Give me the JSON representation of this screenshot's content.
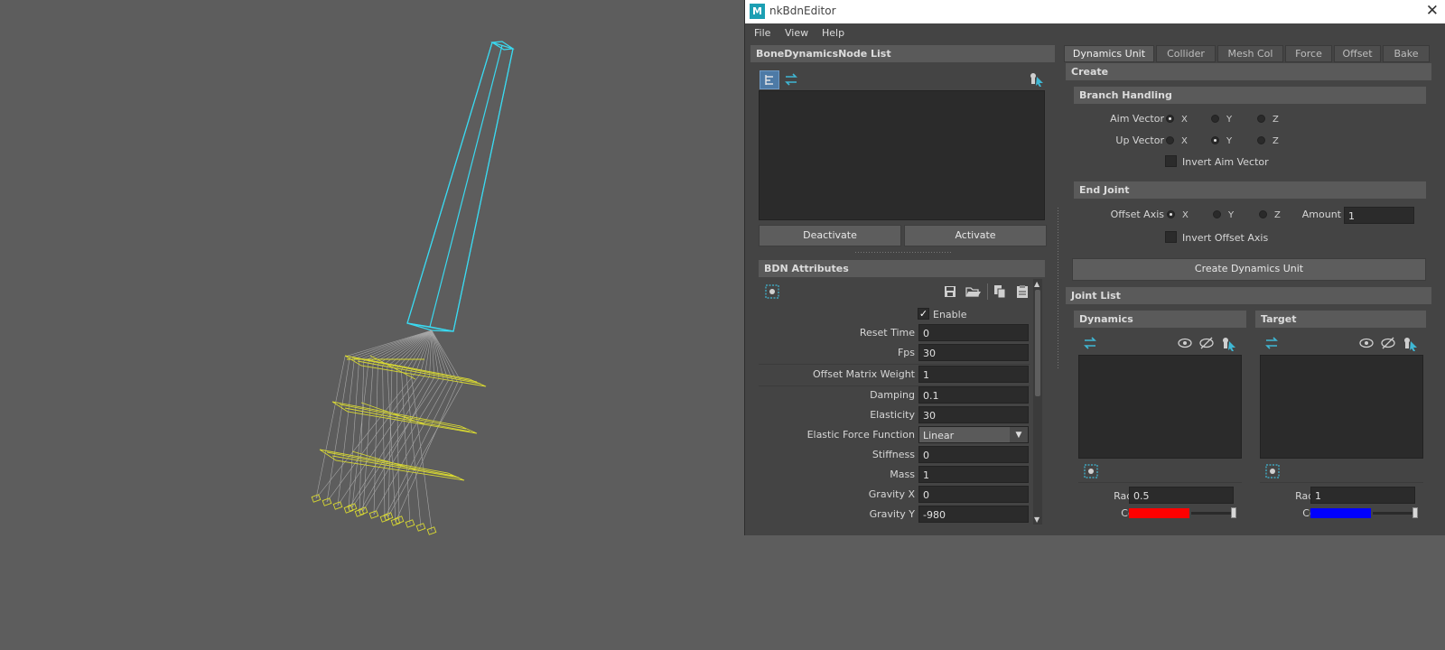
{
  "window": {
    "title": "nkBdnEditor",
    "logo_letter": "M",
    "close_glyph": "✕"
  },
  "menu": [
    "File",
    "View",
    "Help"
  ],
  "left_panel": {
    "list_header": "BoneDynamicsNode List",
    "deactivate": "Deactivate",
    "activate": "Activate",
    "attr_header": "BDN Attributes",
    "enable_label": "Enable",
    "enable_checked": true,
    "attributes": [
      {
        "label": "Reset Time",
        "value": "0"
      },
      {
        "label": "Fps",
        "value": "30"
      },
      {
        "label": "Offset Matrix Weight",
        "value": "1"
      },
      {
        "label": "Damping",
        "value": "0.1"
      },
      {
        "label": "Elasticity",
        "value": "30"
      },
      {
        "label": "Elastic Force Function",
        "value": "Linear"
      },
      {
        "label": "Stiffness",
        "value": "0"
      },
      {
        "label": "Mass",
        "value": "1"
      },
      {
        "label": "Gravity X",
        "value": "0"
      },
      {
        "label": "Gravity Y",
        "value": "-980"
      }
    ]
  },
  "tabs": [
    "Dynamics Unit",
    "Collider",
    "Mesh Col",
    "Force",
    "Offset",
    "Bake"
  ],
  "active_tab": "Dynamics Unit",
  "create": {
    "header": "Create",
    "branch_header": "Branch Handling",
    "aim_label": "Aim Vector",
    "up_label": "Up Vector",
    "axes": [
      "X",
      "Y",
      "Z"
    ],
    "aim_selected": "X",
    "up_selected": "Y",
    "invert_aim": "Invert Aim Vector",
    "end_header": "End Joint",
    "offset_label": "Offset Axis",
    "offset_selected": "X",
    "amount_label": "Amount",
    "amount_value": "1",
    "invert_offset": "Invert Offset Axis",
    "create_button": "Create Dynamics Unit"
  },
  "joint_list": {
    "header": "Joint List",
    "dynamics": {
      "header": "Dynamics",
      "radius_label": "Radius",
      "radius": "0.5",
      "color_label": "Color",
      "color": "#ff0000"
    },
    "target": {
      "header": "Target",
      "radius_label": "Radius",
      "radius": "1",
      "color_label": "Color",
      "color": "#0000ff"
    }
  },
  "colors": {
    "accent": "#1c9fb3",
    "wire_cyan": "#3ad9f0",
    "wire_yellow": "#d8d832"
  }
}
